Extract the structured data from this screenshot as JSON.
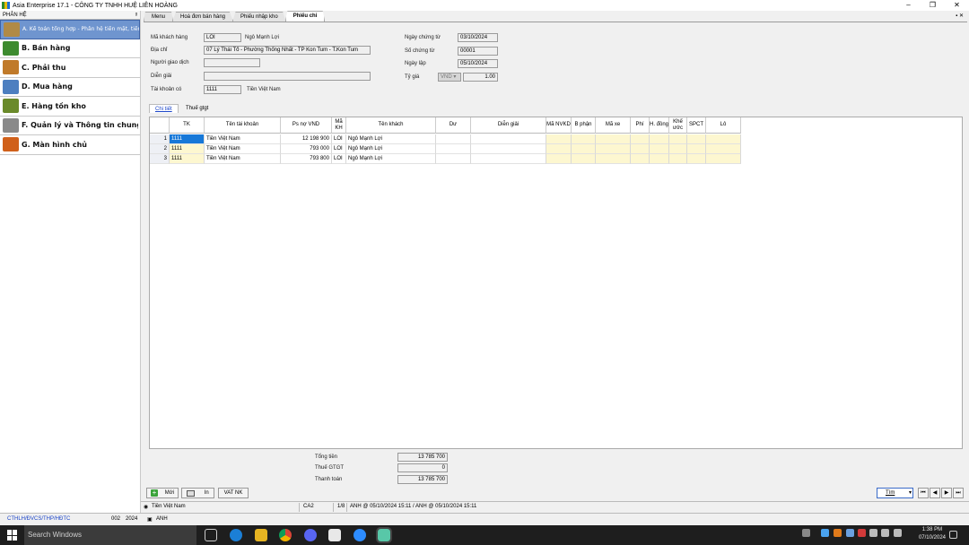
{
  "window": {
    "title": "Asia Enterprise 17.1 - CÔNG TY TNHH HUỆ LIÊN HOÀNG",
    "minimize": "–",
    "maximize": "❐",
    "close": "✕"
  },
  "sidebar": {
    "header": "PHÂN HỆ",
    "pin": "ᵍ",
    "modules": [
      {
        "label": "A. Kế toán tổng hợp - Phân hệ tiền mặt, tiền gửi ngân hàng",
        "icon": "ledger-icon",
        "color": "#b08a46",
        "active": true
      },
      {
        "label": "B. Bán hàng",
        "icon": "basket-icon",
        "color": "#3d8b2f"
      },
      {
        "label": "C. Phải thu",
        "icon": "hand-money-icon",
        "color": "#c07a2a"
      },
      {
        "label": "D. Mua hàng",
        "icon": "cart-icon",
        "color": "#4d7fc0"
      },
      {
        "label": "E. Hàng tồn kho",
        "icon": "crate-icon",
        "color": "#6a8a2a"
      },
      {
        "label": "F. Quản lý và Thông tin chung",
        "icon": "tools-icon",
        "color": "#8a8a8a"
      },
      {
        "label": "G. Màn hình chủ",
        "icon": "home-icon",
        "color": "#d0601a"
      }
    ]
  },
  "tabs": [
    {
      "label": "Menu"
    },
    {
      "label": "Hoá đơn bán hàng"
    },
    {
      "label": "Phiếu nhập kho"
    },
    {
      "label": "Phiếu chi",
      "active": true
    }
  ],
  "tab_controls": "▪ ✕",
  "header": {
    "customer_code_label": "Mã khách hàng",
    "customer_code": "LOI",
    "customer_name": "Ngô Mạnh Lợi",
    "address_label": "Địa chỉ",
    "address": "07 Lý Thái Tổ - Phường Thống Nhất - TP Kon Tum - T.Kon Tum",
    "contact_label": "Người giao dịch",
    "contact": "",
    "description_label": "Diễn giải",
    "description": "",
    "account_label": "Tài khoản có",
    "account": "1111",
    "account_name": "Tiền Việt Nam",
    "voucher_date_label": "Ngày chứng từ",
    "voucher_date": "03/10/2024",
    "voucher_no_label": "Số chứng từ",
    "voucher_no": "00001",
    "created_date_label": "Ngày lập",
    "created_date": "05/10/2024",
    "rate_label": "Tỷ giá",
    "currency": "VND",
    "rate": "1.00"
  },
  "subtabs": [
    {
      "label": "Chi tiết",
      "active": true
    },
    {
      "label": "Thuế gtgt"
    }
  ],
  "grid": {
    "columns": [
      "TK",
      "Tên tài khoản",
      "Ps nợ VND",
      "Mã KH",
      "Tên khách",
      "Dư",
      "Diễn giải",
      "Mã NVKD",
      "B phận",
      "Mã xe",
      "Phí",
      "H. đồng",
      "Khế ước",
      "SPCT",
      "Lô"
    ],
    "rows": [
      {
        "no": "1",
        "tk": "1111",
        "account_name": "Tiền Việt Nam",
        "amount": "12 198 900",
        "cust_code": "LOI",
        "cust_name": "Ngô Mạnh Lợi"
      },
      {
        "no": "2",
        "tk": "1111",
        "account_name": "Tiền Việt Nam",
        "amount": "793 000",
        "cust_code": "LOI",
        "cust_name": "Ngô Mạnh Lợi"
      },
      {
        "no": "3",
        "tk": "1111",
        "account_name": "Tiền Việt Nam",
        "amount": "793 800",
        "cust_code": "LOI",
        "cust_name": "Ngô Mạnh Lợi"
      }
    ]
  },
  "totals": {
    "total_label": "Tổng tiền",
    "total": "13 785 700",
    "vat_label": "Thuế GTGT",
    "vat": "0",
    "pay_label": "Thanh toán",
    "pay": "13 785 700"
  },
  "toolbar": {
    "new": "Mới",
    "print": "In",
    "vat_import": "VAT NK",
    "find": "Tìm",
    "nav": [
      "⏮",
      "◀",
      "▶",
      "⏭"
    ]
  },
  "status": {
    "account": "Tiền Việt Nam",
    "code": "CA2",
    "record": "1/8",
    "audit": "ANH @ 05/10/2024 15:11 / ANH @ 05/10/2024 15:11"
  },
  "bottom": {
    "company": "CTHLH/ĐVCS/THP/HĐTC",
    "period": "002",
    "year": "2024",
    "user": "ANH"
  },
  "taskbar": {
    "search_placeholder": "Search Windows",
    "time": "1:38 PM",
    "date": "07/10/2024"
  }
}
